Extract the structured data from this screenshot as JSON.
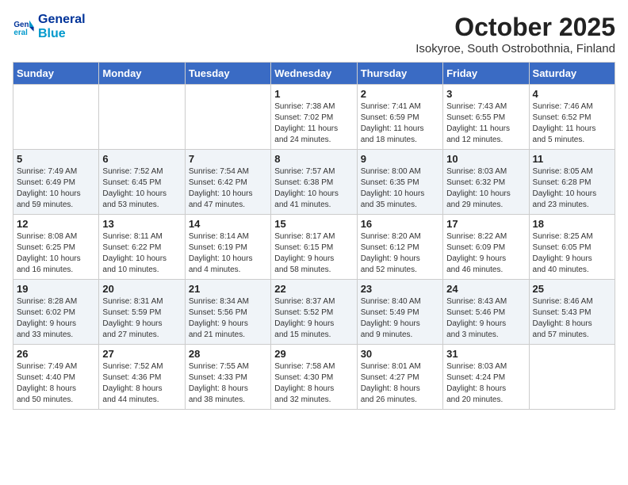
{
  "header": {
    "logo_line1": "General",
    "logo_line2": "Blue",
    "title": "October 2025",
    "subtitle": "Isokyroe, South Ostrobothnia, Finland"
  },
  "weekdays": [
    "Sunday",
    "Monday",
    "Tuesday",
    "Wednesday",
    "Thursday",
    "Friday",
    "Saturday"
  ],
  "weeks": [
    [
      {
        "day": "",
        "info": ""
      },
      {
        "day": "",
        "info": ""
      },
      {
        "day": "",
        "info": ""
      },
      {
        "day": "1",
        "info": "Sunrise: 7:38 AM\nSunset: 7:02 PM\nDaylight: 11 hours\nand 24 minutes."
      },
      {
        "day": "2",
        "info": "Sunrise: 7:41 AM\nSunset: 6:59 PM\nDaylight: 11 hours\nand 18 minutes."
      },
      {
        "day": "3",
        "info": "Sunrise: 7:43 AM\nSunset: 6:55 PM\nDaylight: 11 hours\nand 12 minutes."
      },
      {
        "day": "4",
        "info": "Sunrise: 7:46 AM\nSunset: 6:52 PM\nDaylight: 11 hours\nand 5 minutes."
      }
    ],
    [
      {
        "day": "5",
        "info": "Sunrise: 7:49 AM\nSunset: 6:49 PM\nDaylight: 10 hours\nand 59 minutes."
      },
      {
        "day": "6",
        "info": "Sunrise: 7:52 AM\nSunset: 6:45 PM\nDaylight: 10 hours\nand 53 minutes."
      },
      {
        "day": "7",
        "info": "Sunrise: 7:54 AM\nSunset: 6:42 PM\nDaylight: 10 hours\nand 47 minutes."
      },
      {
        "day": "8",
        "info": "Sunrise: 7:57 AM\nSunset: 6:38 PM\nDaylight: 10 hours\nand 41 minutes."
      },
      {
        "day": "9",
        "info": "Sunrise: 8:00 AM\nSunset: 6:35 PM\nDaylight: 10 hours\nand 35 minutes."
      },
      {
        "day": "10",
        "info": "Sunrise: 8:03 AM\nSunset: 6:32 PM\nDaylight: 10 hours\nand 29 minutes."
      },
      {
        "day": "11",
        "info": "Sunrise: 8:05 AM\nSunset: 6:28 PM\nDaylight: 10 hours\nand 23 minutes."
      }
    ],
    [
      {
        "day": "12",
        "info": "Sunrise: 8:08 AM\nSunset: 6:25 PM\nDaylight: 10 hours\nand 16 minutes."
      },
      {
        "day": "13",
        "info": "Sunrise: 8:11 AM\nSunset: 6:22 PM\nDaylight: 10 hours\nand 10 minutes."
      },
      {
        "day": "14",
        "info": "Sunrise: 8:14 AM\nSunset: 6:19 PM\nDaylight: 10 hours\nand 4 minutes."
      },
      {
        "day": "15",
        "info": "Sunrise: 8:17 AM\nSunset: 6:15 PM\nDaylight: 9 hours\nand 58 minutes."
      },
      {
        "day": "16",
        "info": "Sunrise: 8:20 AM\nSunset: 6:12 PM\nDaylight: 9 hours\nand 52 minutes."
      },
      {
        "day": "17",
        "info": "Sunrise: 8:22 AM\nSunset: 6:09 PM\nDaylight: 9 hours\nand 46 minutes."
      },
      {
        "day": "18",
        "info": "Sunrise: 8:25 AM\nSunset: 6:05 PM\nDaylight: 9 hours\nand 40 minutes."
      }
    ],
    [
      {
        "day": "19",
        "info": "Sunrise: 8:28 AM\nSunset: 6:02 PM\nDaylight: 9 hours\nand 33 minutes."
      },
      {
        "day": "20",
        "info": "Sunrise: 8:31 AM\nSunset: 5:59 PM\nDaylight: 9 hours\nand 27 minutes."
      },
      {
        "day": "21",
        "info": "Sunrise: 8:34 AM\nSunset: 5:56 PM\nDaylight: 9 hours\nand 21 minutes."
      },
      {
        "day": "22",
        "info": "Sunrise: 8:37 AM\nSunset: 5:52 PM\nDaylight: 9 hours\nand 15 minutes."
      },
      {
        "day": "23",
        "info": "Sunrise: 8:40 AM\nSunset: 5:49 PM\nDaylight: 9 hours\nand 9 minutes."
      },
      {
        "day": "24",
        "info": "Sunrise: 8:43 AM\nSunset: 5:46 PM\nDaylight: 9 hours\nand 3 minutes."
      },
      {
        "day": "25",
        "info": "Sunrise: 8:46 AM\nSunset: 5:43 PM\nDaylight: 8 hours\nand 57 minutes."
      }
    ],
    [
      {
        "day": "26",
        "info": "Sunrise: 7:49 AM\nSunset: 4:40 PM\nDaylight: 8 hours\nand 50 minutes."
      },
      {
        "day": "27",
        "info": "Sunrise: 7:52 AM\nSunset: 4:36 PM\nDaylight: 8 hours\nand 44 minutes."
      },
      {
        "day": "28",
        "info": "Sunrise: 7:55 AM\nSunset: 4:33 PM\nDaylight: 8 hours\nand 38 minutes."
      },
      {
        "day": "29",
        "info": "Sunrise: 7:58 AM\nSunset: 4:30 PM\nDaylight: 8 hours\nand 32 minutes."
      },
      {
        "day": "30",
        "info": "Sunrise: 8:01 AM\nSunset: 4:27 PM\nDaylight: 8 hours\nand 26 minutes."
      },
      {
        "day": "31",
        "info": "Sunrise: 8:03 AM\nSunset: 4:24 PM\nDaylight: 8 hours\nand 20 minutes."
      },
      {
        "day": "",
        "info": ""
      }
    ]
  ]
}
